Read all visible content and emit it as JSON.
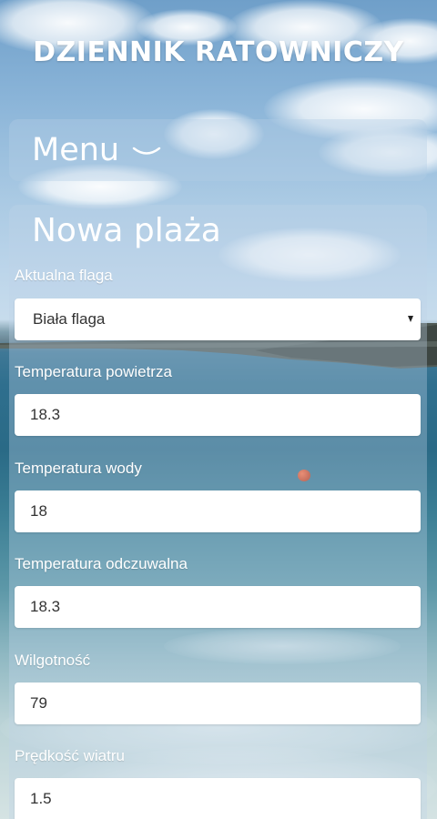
{
  "header": {
    "title": "DZIENNIK RATOWNICZY"
  },
  "menu": {
    "label": "Menu",
    "icon": "chevron-down-icon"
  },
  "form": {
    "title": "Nowa plaża",
    "fields": [
      {
        "label": "Aktualna flaga",
        "type": "select",
        "value": "Biała flaga"
      },
      {
        "label": "Temperatura powietrza",
        "type": "input",
        "value": "18.3"
      },
      {
        "label": "Temperatura wody",
        "type": "input",
        "value": "18"
      },
      {
        "label": "Temperatura odczuwalna",
        "type": "input",
        "value": "18.3"
      },
      {
        "label": "Wilgotność",
        "type": "input",
        "value": "79"
      },
      {
        "label": "Prędkość wiatru",
        "type": "input",
        "value": "1.5"
      }
    ]
  },
  "colors": {
    "text_on_background": "#ffffff",
    "input_background": "#ffffff",
    "input_text": "#333333"
  }
}
